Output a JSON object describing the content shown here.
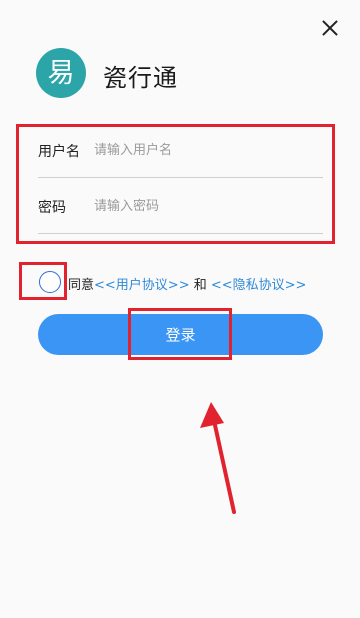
{
  "app": {
    "title": "瓷行通",
    "logo_glyph": "易",
    "logo_color": "#2ca5a9"
  },
  "close_icon": "close-icon",
  "form": {
    "username_label": "用户名",
    "username_placeholder": "请输入用户名",
    "username_value": "",
    "password_label": "密码",
    "password_placeholder": "请输入密码",
    "password_value": ""
  },
  "agreement": {
    "checked": false,
    "prefix": "同意",
    "user_agreement": "<<用户协议>>",
    "connector": " 和 ",
    "privacy_policy": "<<隐私协议>>"
  },
  "login_button": {
    "label": "登录",
    "color": "#3a95f5"
  },
  "annotation_color": "#e0232f"
}
